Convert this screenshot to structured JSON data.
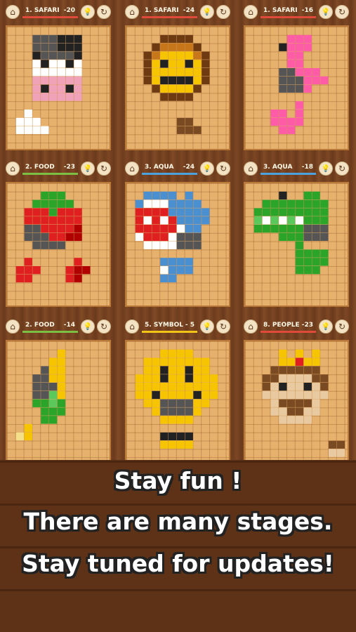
{
  "stages": [
    {
      "category": "1. SAFARI",
      "score": "-20",
      "underline": "#e04a3a",
      "art": "cow"
    },
    {
      "category": "1. SAFARI",
      "score": "-24",
      "underline": "#e04a3a",
      "art": "lion"
    },
    {
      "category": "1. SAFARI",
      "score": "-16",
      "underline": "#e04a3a",
      "art": "flamingo"
    },
    {
      "category": "2. FOOD",
      "score": "-23",
      "underline": "#7bc043",
      "art": "strawberry"
    },
    {
      "category": "3. AQUA",
      "score": "-24",
      "underline": "#4aa3df",
      "art": "shark"
    },
    {
      "category": "3. AQUA",
      "score": "-18",
      "underline": "#4aa3df",
      "art": "crocodile"
    },
    {
      "category": "2. FOOD",
      "score": "-14",
      "underline": "#7bc043",
      "art": "corn"
    },
    {
      "category": "5. SYMBOL",
      "score": "- 5",
      "underline": "#f2c417",
      "art": "smiley"
    },
    {
      "category": "8. PEOPLE",
      "score": "-23",
      "underline": "#e04a3a",
      "art": "king"
    }
  ],
  "icons": {
    "home": "home-icon",
    "hint": "lightbulb-icon",
    "reset": "restart-icon"
  },
  "banner": {
    "line1": "Stay fun !",
    "line2": "There are many stages.",
    "line3": "Stay tuned for updates!"
  }
}
